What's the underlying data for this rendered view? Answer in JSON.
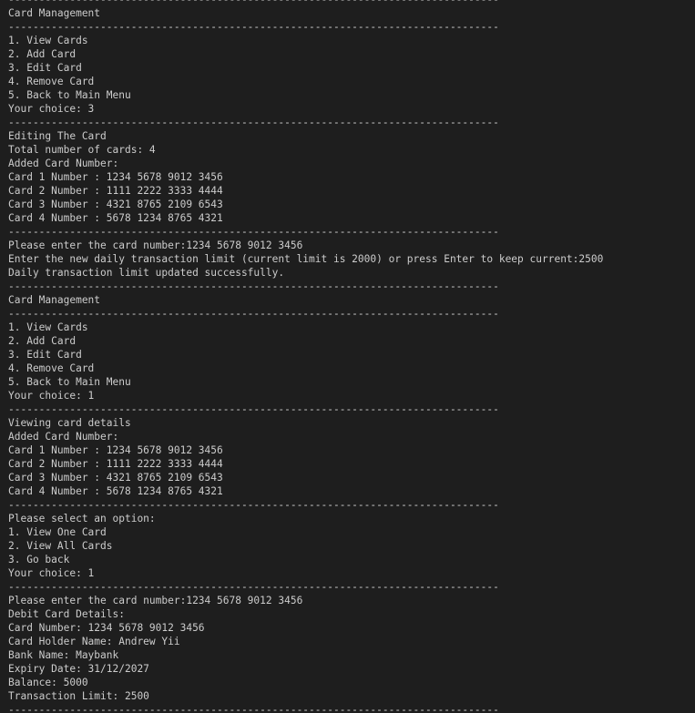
{
  "terminal": {
    "lines": [
      "--------------------------------------------------------------------------------",
      "Card Management",
      "--------------------------------------------------------------------------------",
      "1. View Cards",
      "2. Add Card",
      "3. Edit Card",
      "4. Remove Card",
      "5. Back to Main Menu",
      "Your choice: 3",
      "--------------------------------------------------------------------------------",
      "Editing The Card",
      "Total number of cards: 4",
      "Added Card Number:",
      "Card 1 Number : 1234 5678 9012 3456",
      "Card 2 Number : 1111 2222 3333 4444",
      "Card 3 Number : 4321 8765 2109 6543",
      "Card 4 Number : 5678 1234 8765 4321",
      "--------------------------------------------------------------------------------",
      "Please enter the card number:1234 5678 9012 3456",
      "Enter the new daily transaction limit (current limit is 2000) or press Enter to keep current:2500",
      "Daily transaction limit updated successfully.",
      "--------------------------------------------------------------------------------",
      "Card Management",
      "--------------------------------------------------------------------------------",
      "1. View Cards",
      "2. Add Card",
      "3. Edit Card",
      "4. Remove Card",
      "5. Back to Main Menu",
      "Your choice: 1",
      "--------------------------------------------------------------------------------",
      "Viewing card details",
      "Added Card Number:",
      "Card 1 Number : 1234 5678 9012 3456",
      "Card 2 Number : 1111 2222 3333 4444",
      "Card 3 Number : 4321 8765 2109 6543",
      "Card 4 Number : 5678 1234 8765 4321",
      "--------------------------------------------------------------------------------",
      "Please select an option:",
      "1. View One Card",
      "2. View All Cards",
      "3. Go back",
      "Your choice: 1",
      "--------------------------------------------------------------------------------",
      "Please enter the card number:1234 5678 9012 3456",
      "Debit Card Details:",
      "Card Number: 1234 5678 9012 3456",
      "Card Holder Name: Andrew Yii",
      "Bank Name: Maybank",
      "Expiry Date: 31/12/2027",
      "Balance: 5000",
      "Transaction Limit: 2500",
      "--------------------------------------------------------------------------------"
    ]
  }
}
